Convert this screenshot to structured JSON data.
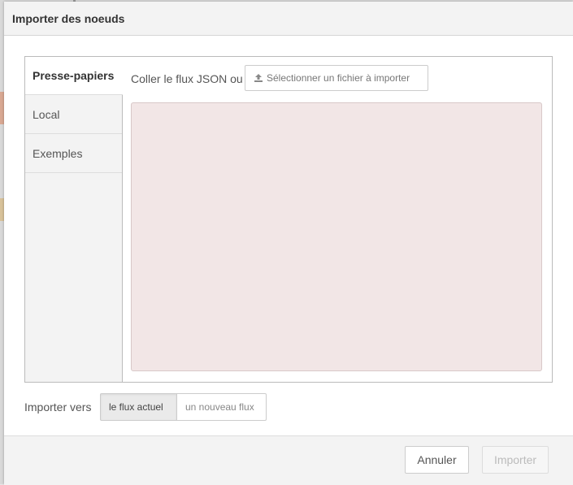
{
  "dialog": {
    "title": "Importer des noeuds"
  },
  "tabs": [
    {
      "label": "Presse-papiers",
      "active": true
    },
    {
      "label": "Local",
      "active": false
    },
    {
      "label": "Exemples",
      "active": false
    }
  ],
  "clipboard": {
    "paste_label": "Coller le flux JSON ou",
    "file_button_label": "Sélectionner un fichier à importer",
    "file_button_icon": "upload-icon",
    "json_value": ""
  },
  "import_target": {
    "label": "Importer vers",
    "options": [
      {
        "label": "le flux actuel",
        "selected": true
      },
      {
        "label": "un nouveau flux",
        "selected": false
      }
    ]
  },
  "footer": {
    "cancel_label": "Annuler",
    "import_label": "Importer",
    "import_disabled": true
  },
  "colors": {
    "json_area_bg": "#f2e6e6",
    "header_bg": "#f3f3f3"
  }
}
